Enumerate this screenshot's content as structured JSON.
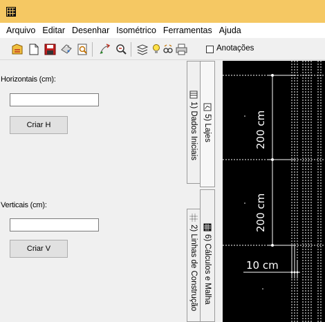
{
  "menu": {
    "items": [
      "Arquivo",
      "Editar",
      "Desenhar",
      "Isométrico",
      "Ferramentas",
      "Ajuda"
    ]
  },
  "toolbar": {
    "annotations_label": "Anotações",
    "annotations_checked": false,
    "tools": [
      "new-drawing-icon",
      "open-icon",
      "save-icon",
      "print-icon",
      "print-preview-icon",
      "add-point-icon",
      "zoom-icon",
      "layers-icon",
      "lightbulb-icon",
      "glasses-icon",
      "printer-icon"
    ]
  },
  "left_panel": {
    "horizontal_label": "Horizontais (cm):",
    "horizontal_value": "",
    "create_h_label": "Criar H",
    "vertical_label": "Verticais (cm):",
    "vertical_value": "",
    "create_v_label": "Criar V"
  },
  "tabs": {
    "dados_iniciais": "1) Dados Iniciais",
    "lajes": "5) Lajes",
    "linhas_construcao": "2) Linhas de Construção",
    "calculos_malha": "6) Cálculos e Malha"
  },
  "canvas": {
    "dim_top": "200 cm",
    "dim_middle": "200 cm",
    "dim_horizontal": "10 cm",
    "colors": {
      "background": "#000000",
      "lines": "#ffffff"
    }
  }
}
